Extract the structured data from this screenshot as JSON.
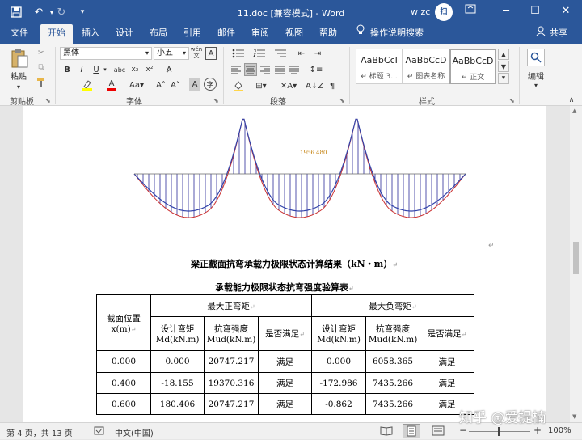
{
  "titlebar": {
    "title": "11.doc [兼容模式] - Word",
    "user": "w zc",
    "avatar_text": "扫"
  },
  "menu": {
    "tabs": [
      "文件",
      "开始",
      "插入",
      "设计",
      "布局",
      "引用",
      "邮件",
      "审阅",
      "视图",
      "帮助"
    ],
    "tell_me": "操作说明搜索",
    "share": "共享"
  },
  "ribbon": {
    "clipboard": {
      "paste": "粘贴",
      "label": "剪贴板"
    },
    "font": {
      "name": "黑体",
      "size": "小五",
      "wen": "wén",
      "A": "A",
      "label": "字体"
    },
    "paragraph": {
      "label": "段落"
    },
    "styles": {
      "items": [
        {
          "sample": "AaBbCcI",
          "name": "↵ 标题 3..."
        },
        {
          "sample": "AaBbCcD",
          "name": "↵ 图表名称"
        },
        {
          "sample": "AaBbCcD",
          "name": "↵ 正文"
        }
      ],
      "label": "样式"
    },
    "editing": {
      "label": "编辑"
    }
  },
  "document": {
    "chart_annotation": "1956.480",
    "heading1": "梁正截面抗弯承载力极限状态计算结果（kN・m）",
    "heading2": "承载能力极限状态抗弯强度验算表",
    "table": {
      "col_position": "截面位置",
      "col_position_unit": "x(m)",
      "group_positive": "最大正弯矩",
      "group_negative": "最大负弯矩",
      "sub_design": "设计弯矩",
      "sub_design_unit": "Md(kN.m)",
      "sub_strength": "抗弯强度",
      "sub_strength_unit": "Mud(kN.m)",
      "sub_ok": "是否满足",
      "rows": [
        [
          "0.000",
          "0.000",
          "20747.217",
          "满足",
          "0.000",
          "6058.365",
          "满足"
        ],
        [
          "0.400",
          "-18.155",
          "19370.316",
          "满足",
          "-172.986",
          "7435.266",
          "满足"
        ],
        [
          "0.600",
          "180.406",
          "20747.217",
          "满足",
          "-0.862",
          "7435.266",
          "满足"
        ]
      ]
    }
  },
  "statusbar": {
    "page": "第 4 页，共 13 页",
    "language": "中文(中国)",
    "zoom": "100%"
  },
  "watermark": "知乎 @爱提楠"
}
